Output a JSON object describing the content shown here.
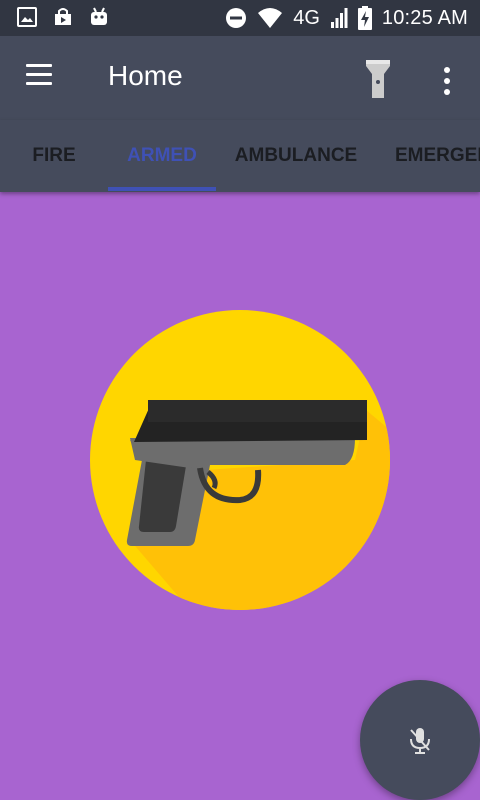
{
  "status_bar": {
    "network": "4G",
    "time": "10:25 AM",
    "icons": [
      "image-icon",
      "shop-icon",
      "android-icon",
      "do-not-disturb-icon",
      "wifi-icon",
      "signal-icon",
      "battery-charging-icon"
    ]
  },
  "app_bar": {
    "title": "Home",
    "icons": [
      "menu-icon",
      "flashlight-icon",
      "more-vert-icon"
    ]
  },
  "tabs": [
    {
      "label": "FIRE",
      "active": false
    },
    {
      "label": "ARMED",
      "active": true
    },
    {
      "label": "AMBULANCE",
      "active": false
    },
    {
      "label": "EMERGENCY",
      "active": false
    }
  ],
  "main": {
    "emblem_icon": "handgun-icon",
    "fab_icon": "microphone-icon"
  },
  "colors": {
    "status_bar": "#313642",
    "app_bar": "#454B5C",
    "accent": "#3F51B5",
    "background": "#A864D0",
    "circle": "#FFD600"
  }
}
